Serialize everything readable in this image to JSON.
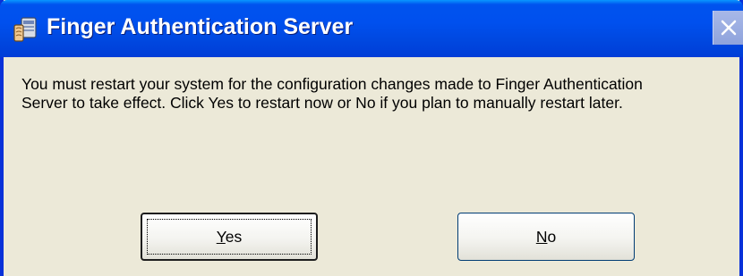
{
  "window": {
    "title": "Finger Authentication Server",
    "icon": "fingerprint-app-icon",
    "close_icon": "close-icon"
  },
  "message": {
    "line1": "You must restart your system for the configuration changes made to Finger Authentication",
    "line2": "Server to take effect. Click Yes to restart now or No if you plan to manually restart later."
  },
  "buttons": {
    "yes": {
      "mnemonic": "Y",
      "rest": "es"
    },
    "no": {
      "mnemonic": "N",
      "rest": "o"
    }
  },
  "colors": {
    "titlebar": "#0054e3",
    "dialog_bg": "#ece9d8",
    "frame": "#0831d9"
  }
}
